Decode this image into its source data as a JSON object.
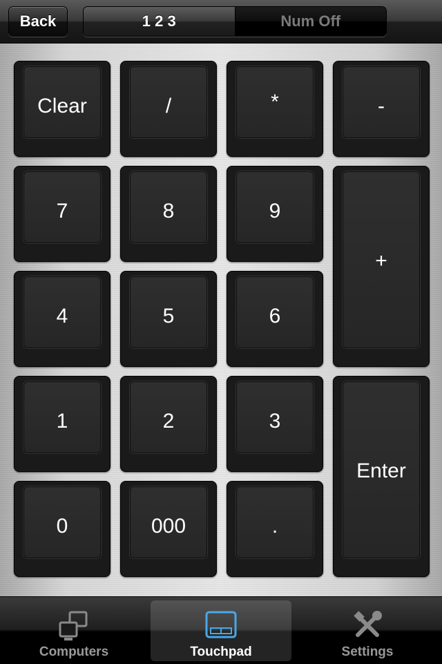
{
  "topbar": {
    "back_label": "Back",
    "segments": [
      {
        "label": "1 2 3",
        "selected": true
      },
      {
        "label": "Num Off",
        "selected": false
      }
    ]
  },
  "keypad": {
    "keys": {
      "clear": "Clear",
      "divide": "/",
      "multiply": "*",
      "minus": "-",
      "seven": "7",
      "eight": "8",
      "nine": "9",
      "plus": "+",
      "four": "4",
      "five": "5",
      "six": "6",
      "one": "1",
      "two": "2",
      "three": "3",
      "enter": "Enter",
      "zero": "0",
      "triple_zero": "000",
      "decimal": "."
    }
  },
  "tabbar": {
    "items": [
      {
        "label": "Computers",
        "icon": "computers-icon",
        "active": false
      },
      {
        "label": "Touchpad",
        "icon": "touchpad-icon",
        "active": true
      },
      {
        "label": "Settings",
        "icon": "settings-tools-icon",
        "active": false
      }
    ]
  },
  "colors": {
    "active_tab_icon": "#4aa8e8",
    "inactive_tab_icon": "#8a8a8a"
  }
}
